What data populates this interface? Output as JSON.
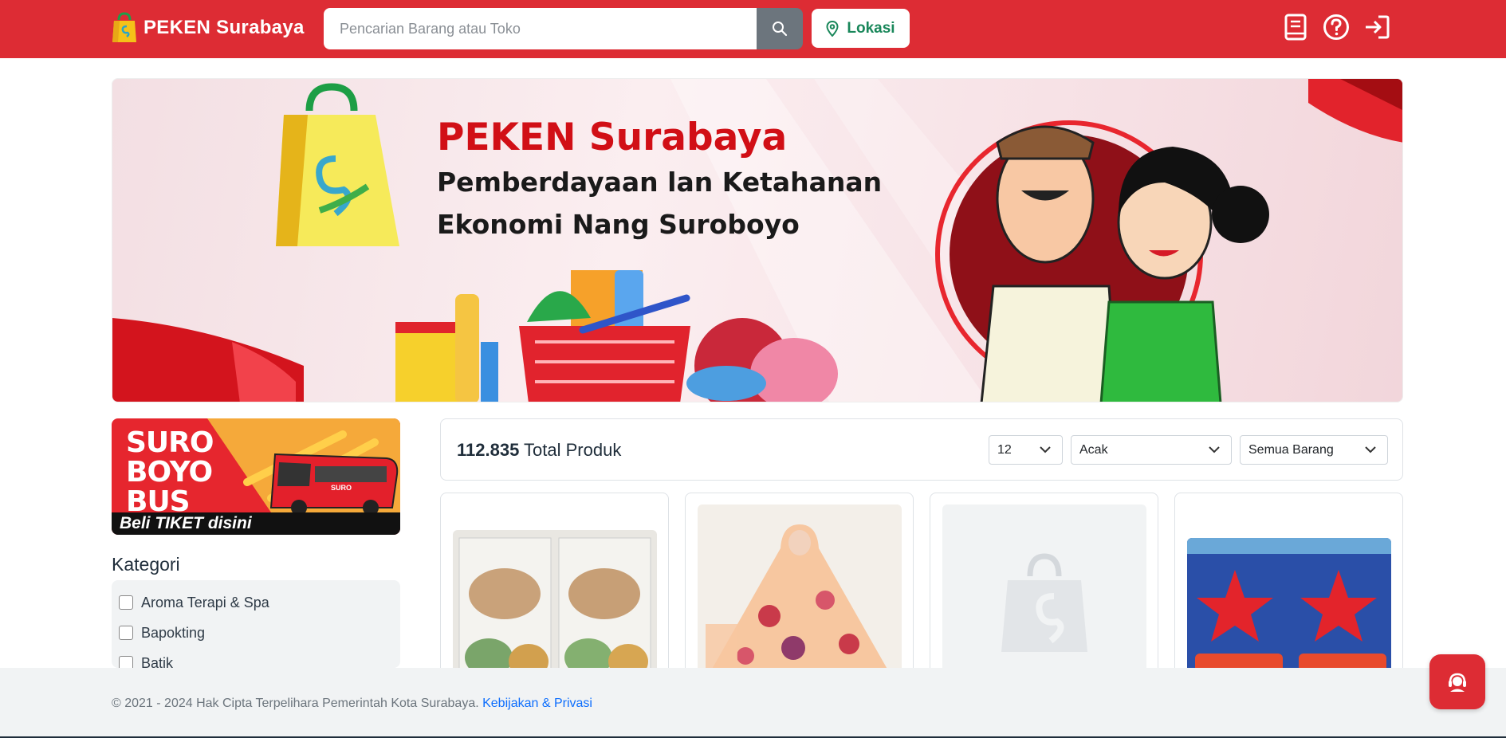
{
  "navbar": {
    "brand": "PEKEN Surabaya",
    "search_placeholder": "Pencarian Barang atau Toko",
    "location_label": "Lokasi",
    "icons": [
      "book-icon",
      "help-icon",
      "login-icon"
    ]
  },
  "banner": {
    "title": "PEKEN Surabaya",
    "subtitle_line1": "Pemberdayaan lan Ketahanan",
    "subtitle_line2": "Ekonomi Nang Suroboyo"
  },
  "promo": {
    "logo_lines": [
      "SURO",
      "BOYO",
      "BUS"
    ],
    "bus_text": "SURO",
    "cta": "Beli TIKET disini"
  },
  "sidebar": {
    "kategori_title": "Kategori",
    "kategori": [
      {
        "label": "Aroma Terapi & Spa",
        "checked": false
      },
      {
        "label": "Bapokting",
        "checked": false
      },
      {
        "label": "Batik",
        "checked": false
      }
    ]
  },
  "products": {
    "total_count": "112.835",
    "total_label": "Total Produk",
    "per_page": "12",
    "sort": "Acak",
    "filter": "Semua Barang",
    "cards": [
      {
        "image": "food-boxes-image"
      },
      {
        "image": "gamis-dress-image"
      },
      {
        "image": "placeholder-bag-image"
      },
      {
        "image": "arek-star-snack-image"
      }
    ]
  },
  "footer": {
    "copyright": "© 2021 - 2024 Hak Cipta Terpelihara Pemerintah Kota Surabaya.",
    "privacy_link": "Kebijakan & Privasi"
  },
  "colors": {
    "primary_red": "#dd2c34",
    "green": "#19875a",
    "link_blue": "#0d6efd"
  }
}
